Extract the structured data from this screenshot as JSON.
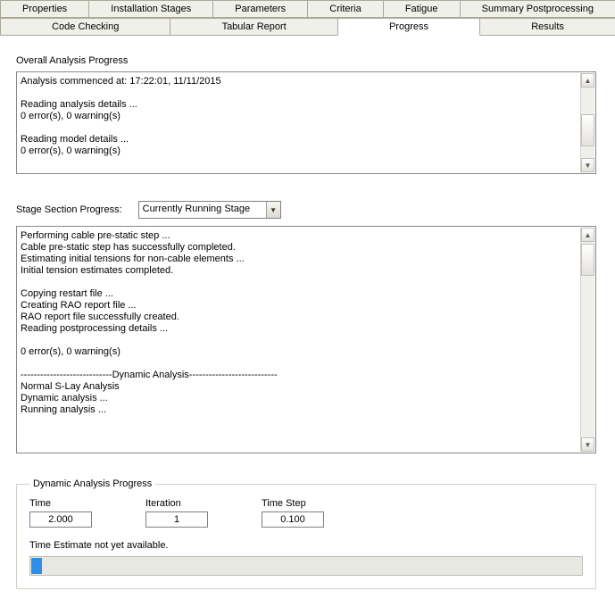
{
  "tabs_row1": [
    {
      "label": "Properties"
    },
    {
      "label": "Installation Stages"
    },
    {
      "label": "Parameters"
    },
    {
      "label": "Criteria"
    },
    {
      "label": "Fatigue"
    },
    {
      "label": "Summary Postprocessing"
    }
  ],
  "tabs_row2": [
    {
      "label": "Code Checking"
    },
    {
      "label": "Tabular Report"
    },
    {
      "label": "Progress",
      "active": true
    },
    {
      "label": "Results"
    }
  ],
  "overall": {
    "label": "Overall Analysis Progress",
    "log": "Analysis commenced at: 17:22:01, 11/11/2015\n\nReading analysis details ...\n0 error(s), 0 warning(s)\n\nReading model details ...\n0 error(s), 0 warning(s)"
  },
  "stage": {
    "label": "Stage Section Progress:",
    "combo_value": "Currently Running Stage",
    "log": "Performing cable pre-static step ...\nCable pre-static step has successfully completed.\nEstimating initial tensions for non-cable elements ...\nInitial tension estimates completed.\n\nCopying restart file ...\nCreating RAO report file ...\nRAO report file successfully created.\nReading postprocessing details ...\n\n0 error(s), 0 warning(s)\n\n----------------------------Dynamic Analysis---------------------------\nNormal S-Lay Analysis\nDynamic analysis ...\nRunning analysis ..."
  },
  "dynamic": {
    "legend": "Dynamic Analysis Progress",
    "time_label": "Time",
    "time_value": "2.000",
    "iter_label": "Iteration",
    "iter_value": "1",
    "step_label": "Time Step",
    "step_value": "0.100",
    "estimate": "Time Estimate not yet available."
  }
}
